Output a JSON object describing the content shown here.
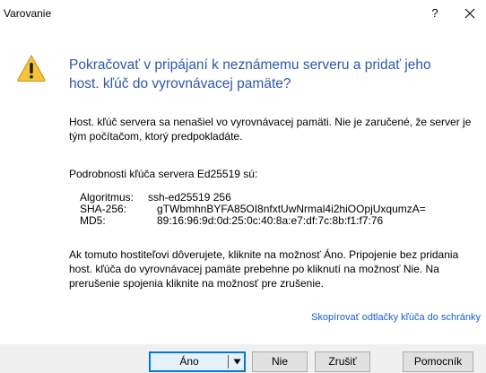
{
  "window": {
    "title": "Varovanie",
    "help_label": "?"
  },
  "heading": "Pokračovať v pripájaní k neznámemu serveru a pridať jeho host. kľúč do vyrovnávacej pamäte?",
  "paragraph1": "Host. kľúč servera sa nenašiel vo vyrovnávacej pamäti. Nie je zaručené, že server je tým počítačom, ktorý predpokladáte.",
  "paragraph2": "Podrobnosti kľúča servera Ed25519 sú:",
  "details": {
    "algorithm_label": "Algoritmus:",
    "algorithm_value": "ssh-ed25519 256",
    "sha_label": "SHA-256:",
    "sha_value": "gTWbmhnBYFA85OI8nfxtUwNrmal4i2hiOOpjUxqumzA=",
    "md5_label": "MD5:",
    "md5_value": "89:16:96:9d:0d:25:0c:40:8a:e7:df:7c:8b:f1:f7:76"
  },
  "paragraph3": "Ak tomuto hostiteľovi dôverujete, kliknite na možnosť Áno. Pripojenie bez pridania host. kľúča do vyrovnávacej pamäte prebehne po kliknutí na možnosť Nie. Na prerušenie spojenia kliknite na možnosť pre zrušenie.",
  "copy_link": "Skopírovať odtlačky kľúča do schránky",
  "buttons": {
    "yes": "Áno",
    "no": "Nie",
    "cancel": "Zrušiť",
    "help": "Pomocník"
  },
  "icons": {
    "warning": "warning-icon",
    "close": "close-icon",
    "dropdown": "dropdown-arrow-icon"
  },
  "colors": {
    "heading": "#2d59a8",
    "link": "#1a5dc8",
    "warning_fill": "#f6c33b",
    "default_button_border": "#0078d7"
  }
}
